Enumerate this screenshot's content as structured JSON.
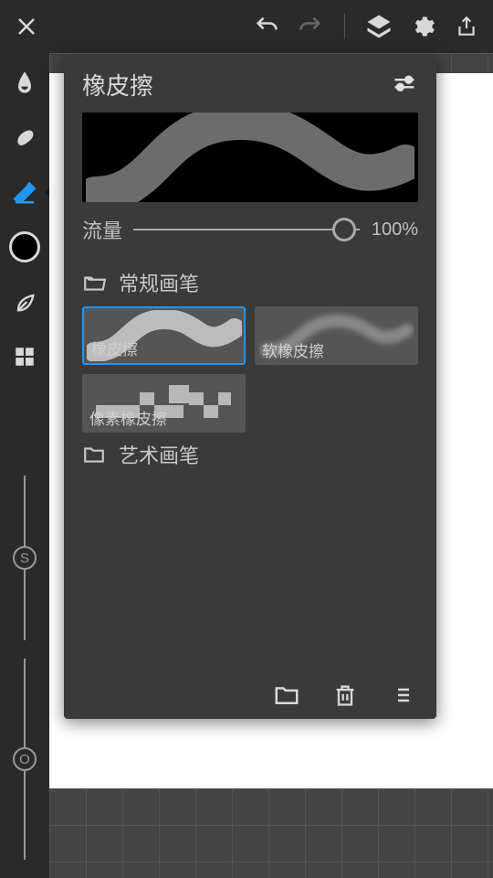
{
  "panel": {
    "title": "橡皮擦",
    "flow_label": "流量",
    "flow_value": "100%"
  },
  "folders": {
    "common": "常规画笔",
    "art": "艺术画笔"
  },
  "presets": {
    "eraser": "橡皮擦",
    "soft": "软橡皮擦",
    "pixel": "像素橡皮擦"
  },
  "vslider": {
    "top_handle": "S",
    "bottom_handle": "O"
  }
}
